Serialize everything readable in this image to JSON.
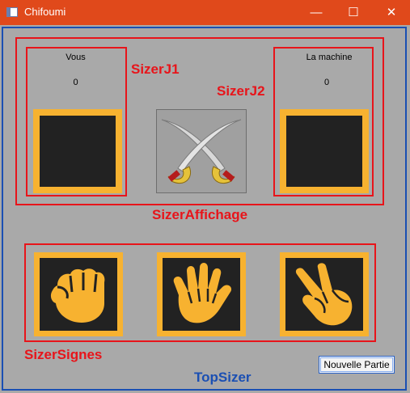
{
  "window": {
    "title": "Chifoumi",
    "min_glyph": "—",
    "max_glyph": "☐",
    "close_glyph": "✕"
  },
  "labels": {
    "sizer_j1": "SizerJ1",
    "sizer_j2": "SizerJ2",
    "sizer_affichage": "SizerAffichage",
    "sizer_signes": "SizerSignes",
    "top_sizer": "TopSizer"
  },
  "player": {
    "name": "Vous",
    "score": "0"
  },
  "machine": {
    "name": "La machine",
    "score": "0"
  },
  "signs": [
    {
      "icon": "fist-icon"
    },
    {
      "icon": "open-hand-icon"
    },
    {
      "icon": "victory-hand-icon"
    }
  ],
  "buttons": {
    "new_game": "Nouvelle Partie"
  },
  "colors": {
    "titlebar": "#e0491b",
    "sizer_red": "#e8141a",
    "top_sizer_blue": "#1a4fb3",
    "tile_gold": "#f7b230",
    "tile_inner": "#222222"
  }
}
